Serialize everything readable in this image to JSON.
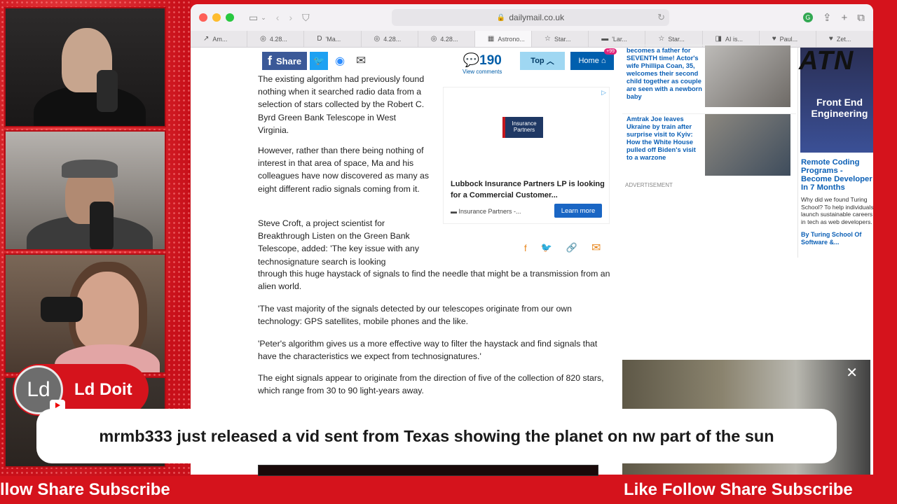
{
  "stream": {
    "host_name": "Ld Doit",
    "host_initials": "Ld",
    "caption": "mrmb333 just released a vid sent from Texas showing the planet on nw part of the sun",
    "ticker_left": "llow Share Subscribe",
    "ticker_right": "Like Follow Share Subscribe",
    "logo": "ATN",
    "accent_color": "#d5131c"
  },
  "browser": {
    "url": "dailymail.co.uk",
    "tabs": [
      {
        "label": "Am...",
        "icon": "↗"
      },
      {
        "label": "4.28...",
        "icon": "◎"
      },
      {
        "label": "'Ma...",
        "icon": "D"
      },
      {
        "label": "4.28...",
        "icon": "◎"
      },
      {
        "label": "4.28...",
        "icon": "◎"
      },
      {
        "label": "Astrono...",
        "icon": "▦"
      },
      {
        "label": "Star...",
        "icon": "☆"
      },
      {
        "label": "'Lar...",
        "icon": "▬"
      },
      {
        "label": "Star...",
        "icon": "☆"
      },
      {
        "label": "AI is...",
        "icon": "◨"
      },
      {
        "label": "Paul...",
        "icon": "♥"
      },
      {
        "label": "Zet...",
        "icon": "♥"
      }
    ]
  },
  "article": {
    "share_label": "Share",
    "comment_count": "190",
    "comments_label": "View comments",
    "top_label": "Top",
    "home_label": "Home",
    "home_badge": "+99",
    "paragraphs": {
      "p1": "The existing algorithm had previously found nothing when it searched radio data from a selection of stars collected by the Robert C. Byrd Green Bank Telescope in West Virginia.",
      "p2": "However, rather than there being nothing of interest in that area of space, Ma and his colleagues have now discovered as many as eight different radio signals coming from it.",
      "p3": "Steve Croft, a project scientist for Breakthrough Listen on the Green Bank Telescope, added: 'The key issue with any technosignature search is looking",
      "p3b": "through this huge haystack of signals to find the needle that might be a transmission from an alien world.",
      "p4": "'The vast majority of the signals detected by our telescopes originate from our own technology: GPS satellites, mobile phones and the like.",
      "p5": "'Peter's algorithm gives us a more effective way to filter the haystack and find signals that have the characteristics we expect from technosignatures.'",
      "p6": "The eight signals appear to originate from the direction of five of the collection of 820 stars, which range from 30 to 90 light-years away."
    }
  },
  "ad": {
    "logo_text": "Insurance Partners",
    "title": "Lubbock Insurance Partners LP is looking for a Commercial Customer...",
    "source": "Insurance Partners -...",
    "button": "Learn more"
  },
  "sidebar": {
    "items": [
      {
        "text": "becomes a father for SEVENTH time! Actor's wife Phillipa Coan, 35, welcomes their second child together as couple are seen with a newborn baby"
      },
      {
        "text": "Amtrak Joe leaves Ukraine by train after surprise visit to Kyiv: How the White House pulled off Biden's visit to a warzone"
      }
    ],
    "advertisement_label": "ADVERTISEMENT"
  },
  "right_ad": {
    "image_text": "Front End Engineering",
    "title": "Remote Coding Programs - Become Developer In 7 Months",
    "desc": "Why did we found Turing School? To help individuals launch sustainable careers in tech as web developers.",
    "by": "By Turing School Of Software &..."
  }
}
